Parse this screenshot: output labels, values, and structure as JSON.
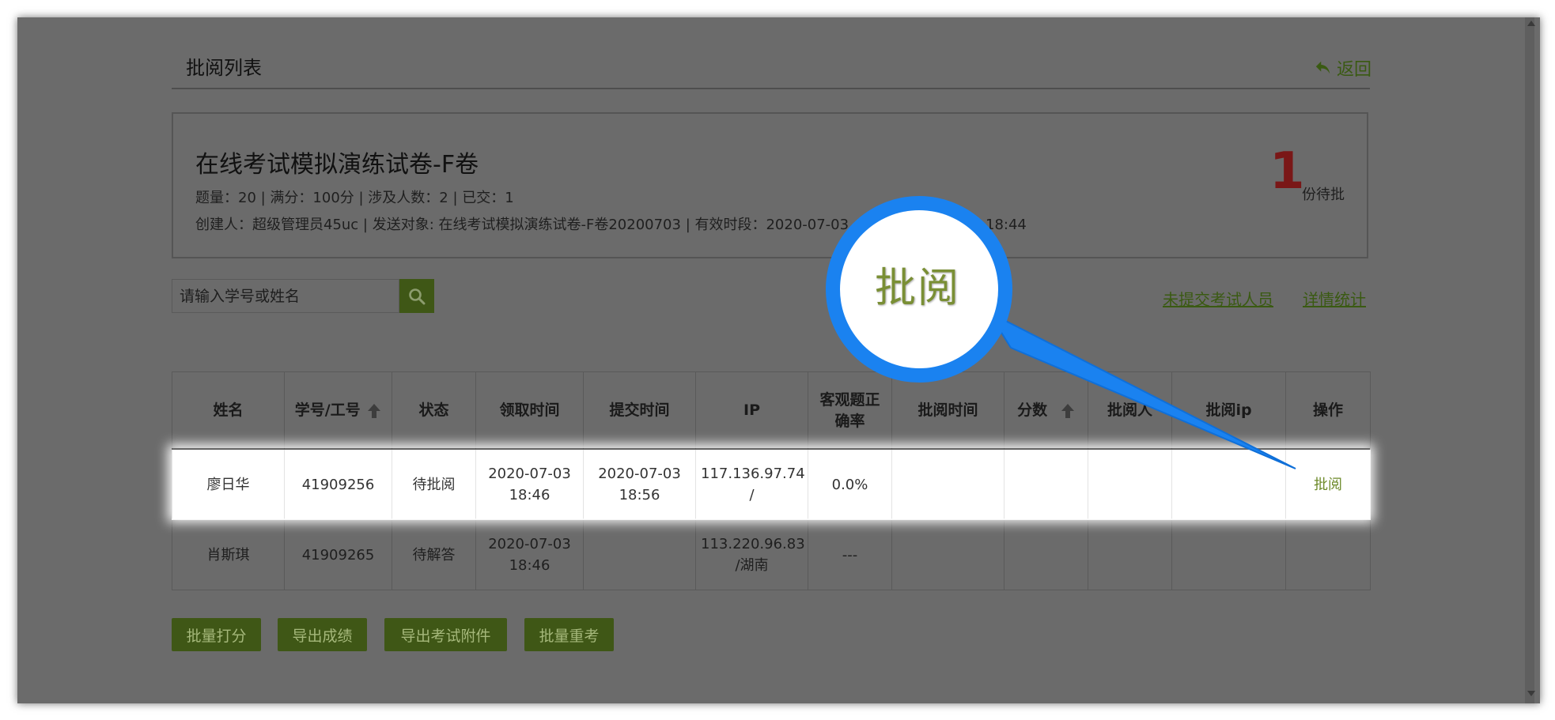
{
  "header": {
    "title": "批阅列表",
    "back_label": "返回"
  },
  "exam": {
    "title": "在线考试模拟演练试卷-F卷",
    "meta_line1": "题量：20 |  满分：100分 |  涉及人数：2 | 已交：1",
    "meta_line2": "创建人：超级管理员45uc | 发送对象:   在线考试模拟演练试卷-F卷20200703  |  有效时段：2020-07-03",
    "meta_line2_tail": "4 18:44",
    "pending_count": "1",
    "pending_label": "份待批"
  },
  "search": {
    "placeholder": "请输入学号或姓名"
  },
  "links": {
    "unsubmitted": "未提交考试人员",
    "stats": "详情统计"
  },
  "table": {
    "columns": {
      "name": "姓名",
      "id": "学号/工号",
      "status": "状态",
      "receive": "领取时间",
      "submit": "提交时间",
      "ip": "IP",
      "accuracy": "客观题正确率",
      "review_time": "批阅时间",
      "score": "分数",
      "reviewer": "批阅人",
      "review_ip": "批阅ip",
      "action": "操作"
    },
    "rows": [
      {
        "name": "廖日华",
        "id": "41909256",
        "status": "待批阅",
        "receive_date": "2020-07-03",
        "receive_time": "18:46",
        "submit_date": "2020-07-03",
        "submit_time": "18:56",
        "ip_line1": "117.136.97.74",
        "ip_line2": "/",
        "accuracy": "0.0%",
        "review_time": "",
        "score": "",
        "reviewer": "",
        "review_ip": "",
        "action": "批阅"
      },
      {
        "name": "肖斯琪",
        "id": "41909265",
        "status": "待解答",
        "receive_date": "2020-07-03",
        "receive_time": "18:46",
        "submit_date": "",
        "submit_time": "",
        "ip_line1": "113.220.96.83",
        "ip_line2": "/湖南",
        "accuracy": "---",
        "review_time": "",
        "score": "",
        "reviewer": "",
        "review_ip": "",
        "action": ""
      }
    ]
  },
  "actions": {
    "batch_score": "批量打分",
    "export_scores": "导出成绩",
    "export_attachments": "导出考试附件",
    "batch_retake": "批量重考"
  },
  "callout": {
    "text": "批阅"
  },
  "colors": {
    "overlay": "#6b6b6b",
    "accent_green": "#3f5716",
    "link_green": "#3a5a12",
    "pending_red": "#7a1717",
    "status_red": "#c0281e",
    "callout_blue": "#1a82f0"
  }
}
